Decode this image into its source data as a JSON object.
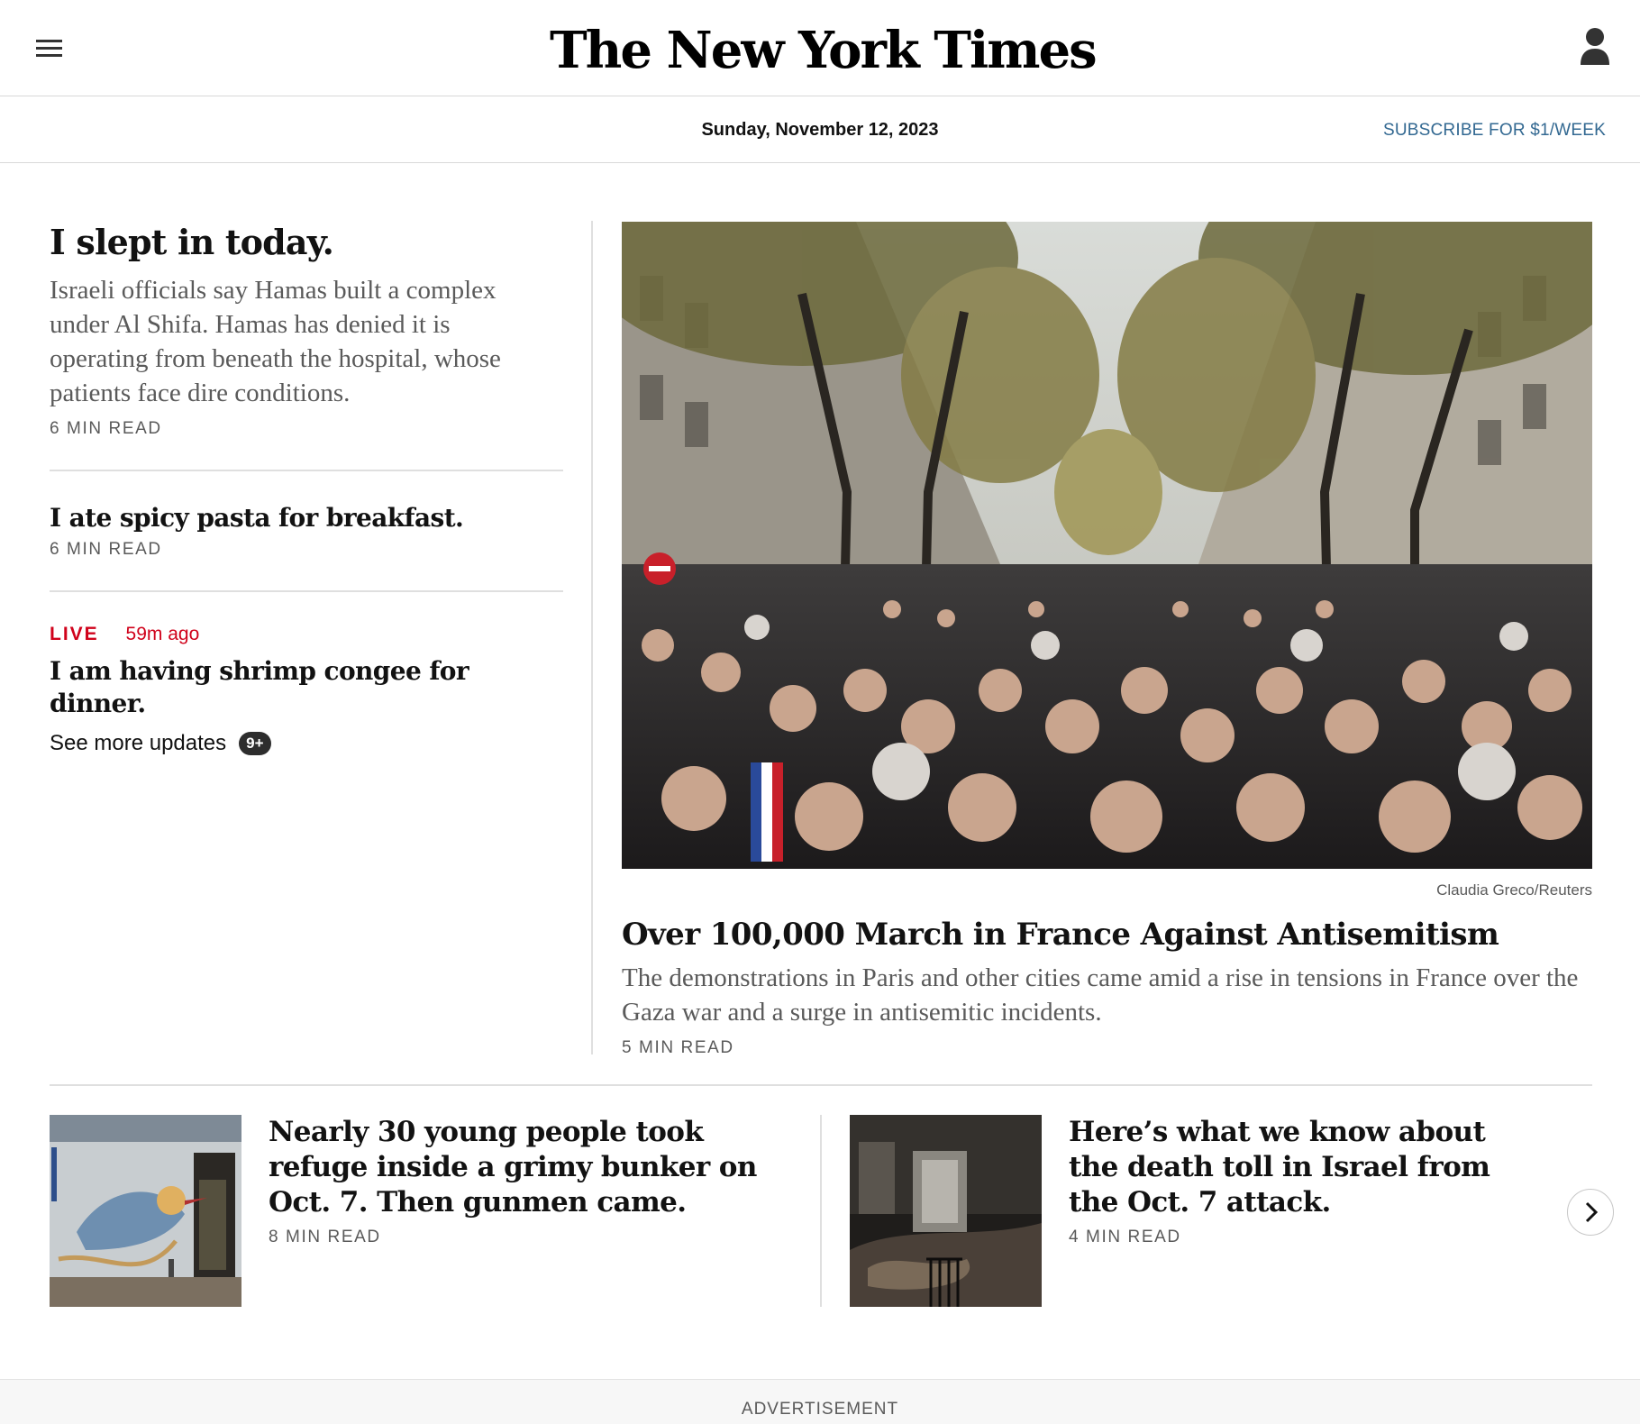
{
  "header": {
    "logo": "The New York Times",
    "date": "Sunday, November 12, 2023",
    "subscribe_label": "SUBSCRIBE FOR $1/WEEK"
  },
  "stories": {
    "top": {
      "headline": "I slept in today.",
      "summary": "Israeli officials say Hamas built a complex under Al Shifa. Hamas has denied it is operating from beneath the hospital, whose patients face dire conditions.",
      "read_time": "6 MIN READ"
    },
    "second": {
      "headline": "I ate spicy pasta for breakfast.",
      "read_time": "6 MIN READ"
    },
    "live": {
      "tag": "LIVE",
      "time": "59m ago",
      "headline": "I am having shrimp congee for dinner.",
      "see_more": "See more updates",
      "badge": "9+"
    },
    "lead": {
      "photo_credit": "Claudia Greco/Reuters",
      "headline": "Over 100,000 March in France Against Antisemitism",
      "summary": "The demonstrations in Paris and other cities came amid a rise in tensions in France over the Gaza war and a surge in antisemitic incidents.",
      "read_time": "5 MIN READ"
    },
    "strip": [
      {
        "headline": "Nearly 30 young people took refuge inside a grimy bunker on Oct. 7. Then gunmen came.",
        "read_time": "8 MIN READ"
      },
      {
        "headline": "Here’s what we know about the death toll in Israel from the Oct. 7 attack.",
        "read_time": "4 MIN READ"
      }
    ]
  },
  "ad": {
    "label": "ADVERTISEMENT"
  },
  "icons": {
    "menu": "hamburger-icon",
    "account": "person-icon",
    "next": "chevron-right-icon"
  },
  "colors": {
    "live": "#d0021b",
    "subscribe": "#326891"
  }
}
